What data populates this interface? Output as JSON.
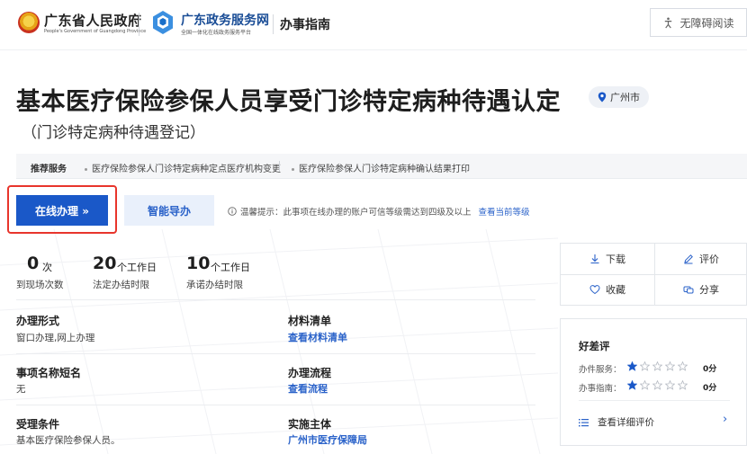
{
  "header": {
    "gov_name": "广东省人民政府",
    "gov_sub": "People's Government of Guangdong Province",
    "service_name": "广东政务服务网",
    "service_sub": "全国一体化在线政务服务平台",
    "guide_label": "办事指南",
    "accessibility_label": "无障碍阅读"
  },
  "title": {
    "main": "基本医疗保险参保人员享受门诊特定病种待遇认定",
    "sub": "（门诊特定病种待遇登记）",
    "location": "广州市"
  },
  "recommend": {
    "label": "推荐服务",
    "items": [
      "医疗保险参保人门诊特定病种定点医疗机构变更",
      "医疗保险参保人门诊特定病种确认结果打印"
    ]
  },
  "actions": {
    "online_label": "在线办理 »",
    "guide_label": "智能导办",
    "tip_text": "温馨提示：此事项在线办理的账户可信等级需达到四级及以上",
    "tip_link": "查看当前等级"
  },
  "stats": [
    {
      "value": "0",
      "unit": "次",
      "label": "到现场次数"
    },
    {
      "value": "20",
      "unit": "个工作日",
      "label": "法定办结时限"
    },
    {
      "value": "10",
      "unit": "个工作日",
      "label": "承诺办结时限"
    }
  ],
  "info": {
    "row1": {
      "left_head": "办理形式",
      "left_val": "窗口办理,网上办理",
      "right_head": "材料清单",
      "right_link": "查看材料清单"
    },
    "row2": {
      "left_head": "事项名称短名",
      "left_val": "无",
      "right_head": "办理流程",
      "right_link": "查看流程"
    },
    "row3": {
      "left_head": "受理条件",
      "left_val": "基本医疗保险参保人员。",
      "right_head": "实施主体",
      "right_link": "广州市医疗保障局"
    }
  },
  "side_actions": {
    "download": "下载",
    "evaluate": "评价",
    "favorite": "收藏",
    "share": "分享"
  },
  "rating": {
    "title": "好差评",
    "rows": [
      {
        "label": "办件服务：",
        "stars": 1,
        "score": "0分"
      },
      {
        "label": "办事指南：",
        "stars": 1,
        "score": "0分"
      }
    ],
    "more_label": "查看详细评价"
  },
  "colors": {
    "primary": "#1a58c8",
    "link": "#2a62c9",
    "highlight": "#e8352c",
    "star_filled": "#1a58c8"
  }
}
